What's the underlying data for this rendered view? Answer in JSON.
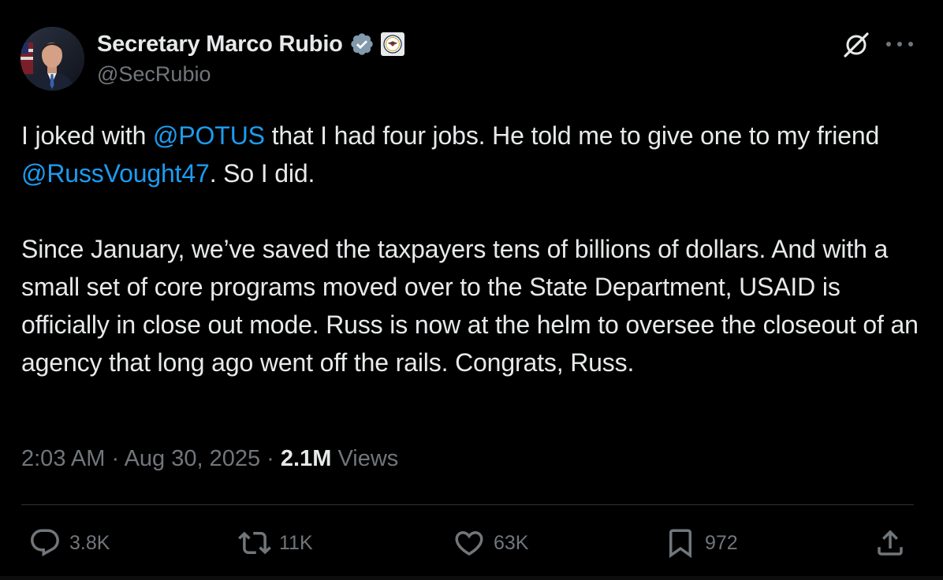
{
  "author": {
    "display_name": "Secretary Marco Rubio",
    "handle": "@SecRubio",
    "verified_color": "#829aab",
    "badge_icon": "state-department-seal-icon"
  },
  "header_actions": {
    "grok_icon": "grok-icon",
    "more_icon": "more-icon"
  },
  "tweet": {
    "p1": {
      "t1": "I joked with ",
      "m1": "@POTUS",
      "t2": " that I had four jobs. He told me to give one to my friend ",
      "m2": "@RussVought47",
      "t3": ". So I did."
    },
    "p2": "Since January, we’ve saved the taxpayers tens of billions of dollars. And with a small set of core programs moved over to the State Department, USAID is officially in close out mode. Russ is now at the helm to oversee the closeout of an agency that long ago went off the rails. Congrats, Russ.",
    "mention_color": "#1d9bf0"
  },
  "meta": {
    "time": "2:03 AM",
    "separator": " · ",
    "date": "Aug 30, 2025",
    "views_count": "2.1M",
    "views_label": " Views"
  },
  "actions": {
    "replies": "3.8K",
    "retweets": "11K",
    "likes": "63K",
    "bookmarks": "972"
  }
}
